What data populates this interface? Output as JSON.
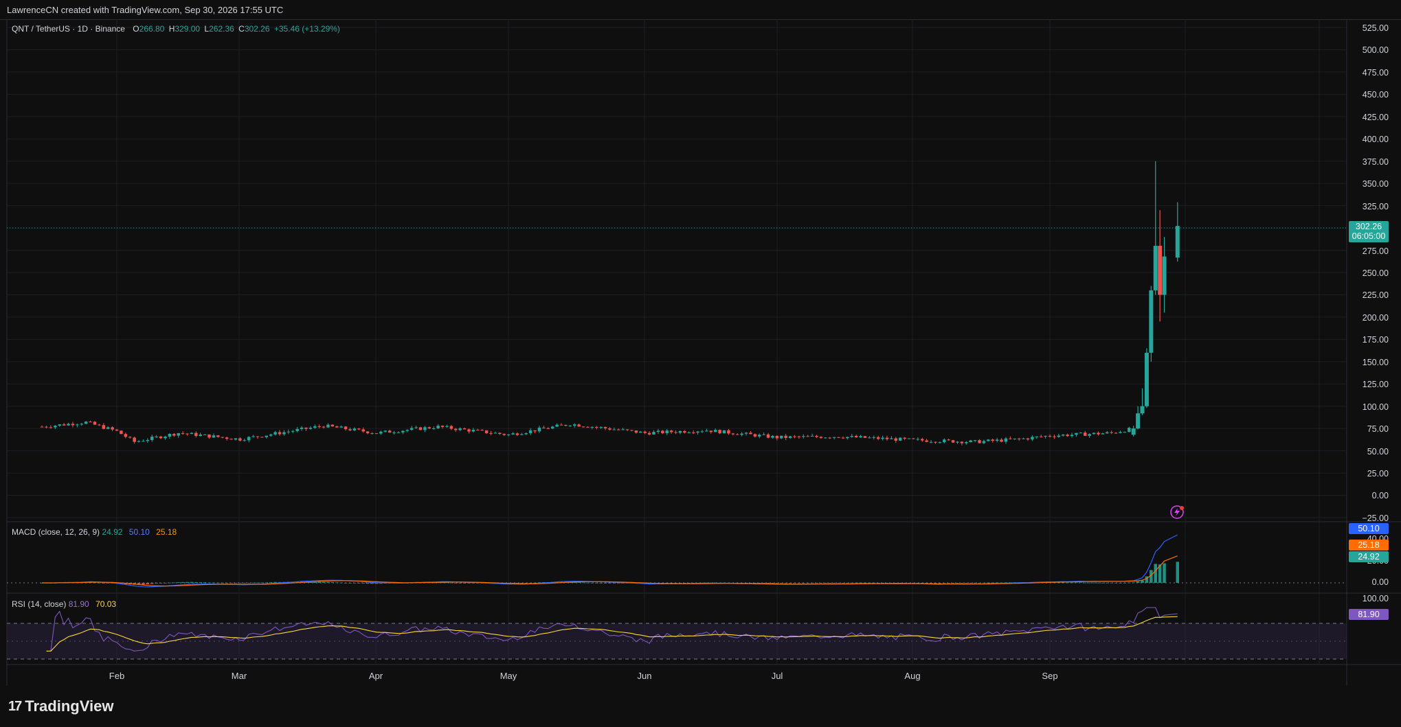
{
  "header": {
    "attribution": "LawrenceCN created with TradingView.com, Sep 30, 2026 17:55 UTC"
  },
  "symbol_legend": {
    "symbol": "QNT / TetherUS · 1D · Binance",
    "open_key": "O",
    "open": "266.80",
    "high_key": "H",
    "high": "329.00",
    "low_key": "L",
    "low": "262.36",
    "close_key": "C",
    "close": "302.26",
    "change": "+35.46 (+13.29%)"
  },
  "price_axis": {
    "ticks": [
      "525.00",
      "500.00",
      "475.00",
      "450.00",
      "425.00",
      "400.00",
      "375.00",
      "350.00",
      "325.00",
      "300.00",
      "275.00",
      "250.00",
      "225.00",
      "200.00",
      "175.00",
      "150.00",
      "125.00",
      "100.00",
      "75.00",
      "50.00",
      "25.00",
      "0.00",
      "−25.00"
    ],
    "last_price": "302.26",
    "countdown": "06:05:00",
    "last_price_color": "#26a69a"
  },
  "macd": {
    "label": "MACD (close, 12, 26, 9)",
    "hist": "24.92",
    "macd": "50.10",
    "signal": "25.18",
    "axis_ticks": [
      "40.00",
      "20.00",
      "0.00"
    ],
    "colors": {
      "hist": "#26a69a",
      "macd": "#2962ff",
      "signal": "#ff6d00"
    }
  },
  "rsi": {
    "label": "RSI (14, close)",
    "rsi": "81.90",
    "ma": "70.03",
    "axis_ticks": [
      "100.00"
    ],
    "colors": {
      "rsi": "#7e57c2",
      "ma": "#fdd835"
    }
  },
  "time_axis": [
    "Feb",
    "Mar",
    "Apr",
    "May",
    "Jun",
    "Jul",
    "Aug",
    "Sep"
  ],
  "footer": {
    "brand": "TradingView",
    "brand_mark": "17"
  },
  "chart_data": {
    "type": "candlestick",
    "symbol": "QNT/USDT",
    "timeframe": "1D",
    "ylim": [
      -25,
      525
    ],
    "last_close": 302.26,
    "approx_closes": [
      {
        "date": "2026-01-15",
        "close": 77
      },
      {
        "date": "2026-01-25",
        "close": 82
      },
      {
        "date": "2026-02-01",
        "close": 72
      },
      {
        "date": "2026-02-05",
        "close": 60
      },
      {
        "date": "2026-02-15",
        "close": 70
      },
      {
        "date": "2026-03-01",
        "close": 63
      },
      {
        "date": "2026-03-20",
        "close": 78
      },
      {
        "date": "2026-04-01",
        "close": 70
      },
      {
        "date": "2026-04-15",
        "close": 77
      },
      {
        "date": "2026-05-01",
        "close": 68
      },
      {
        "date": "2026-05-15",
        "close": 80
      },
      {
        "date": "2026-06-01",
        "close": 70
      },
      {
        "date": "2026-06-15",
        "close": 73
      },
      {
        "date": "2026-07-01",
        "close": 65
      },
      {
        "date": "2026-07-15",
        "close": 66
      },
      {
        "date": "2026-08-01",
        "close": 62
      },
      {
        "date": "2026-08-15",
        "close": 60
      },
      {
        "date": "2026-08-25",
        "close": 63
      },
      {
        "date": "2026-09-01",
        "close": 67
      },
      {
        "date": "2026-09-15",
        "close": 70
      },
      {
        "date": "2026-09-20",
        "close": 75
      },
      {
        "date": "2026-09-22",
        "close": 100
      },
      {
        "date": "2026-09-24",
        "close": 160
      },
      {
        "date": "2026-09-25",
        "close": 280
      },
      {
        "date": "2026-09-26",
        "close": 225
      },
      {
        "date": "2026-09-28",
        "close": 270
      },
      {
        "date": "2026-09-30",
        "close": 302.26
      }
    ]
  }
}
